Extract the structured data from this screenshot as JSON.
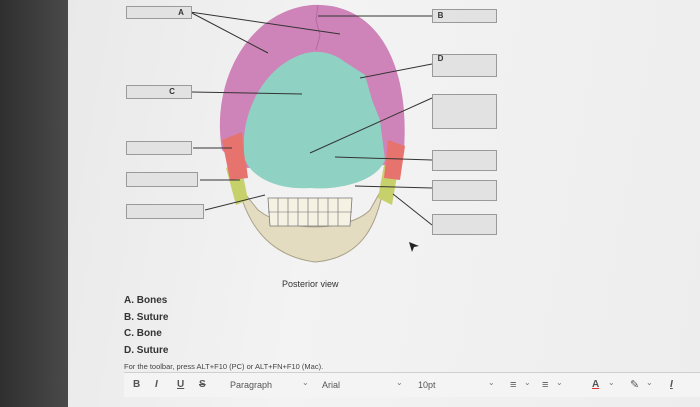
{
  "labels": {
    "a": "A",
    "b": "B",
    "c": "C",
    "d": "D"
  },
  "figure": {
    "caption": "Posterior view"
  },
  "answers": [
    "A. Bones",
    "B. Suture",
    "C. Bone",
    "D. Suture"
  ],
  "help_text": "For the toolbar, press ALT+F10 (PC) or ALT+FN+F10 (Mac).",
  "toolbar": {
    "bold": "B",
    "italic": "I",
    "underline": "U",
    "strike": "S",
    "paragraph": "Paragraph",
    "font": "Arial",
    "size": "10pt",
    "font_color": "A",
    "clear": "I"
  },
  "colors": {
    "parietal": "#cf84b9",
    "occipital": "#8fd1c2",
    "temporal": "#e7736f",
    "mastoid": "#c7d16b",
    "jaw": "#e4dcc0"
  },
  "icons": [
    "bullet-list-icon",
    "numbered-list-icon",
    "font-color-icon",
    "highlight-pen-icon",
    "clear-format-icon",
    "chevron-down-icon"
  ]
}
